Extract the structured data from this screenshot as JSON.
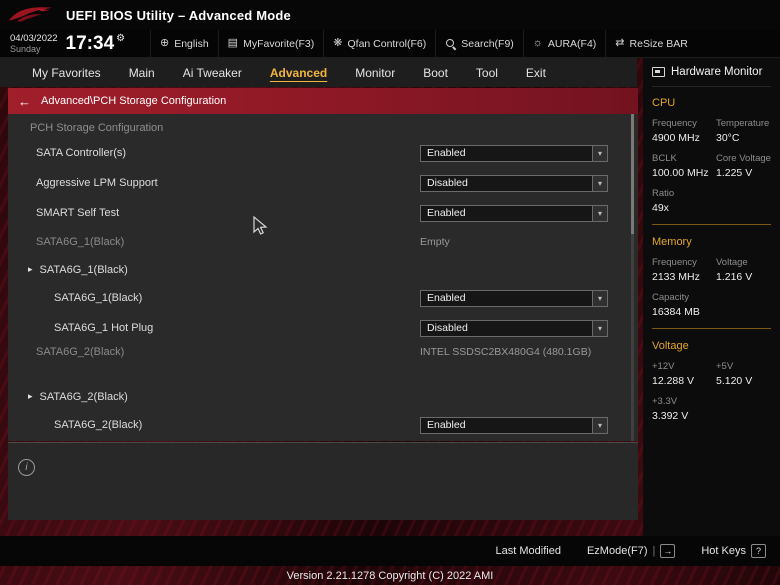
{
  "header": {
    "title": "UEFI BIOS Utility – Advanced Mode",
    "date": "04/03/2022",
    "day": "Sunday",
    "time": "17:34",
    "tools": [
      {
        "label": "English",
        "icon": "globe-icon"
      },
      {
        "label": "MyFavorite(F3)",
        "icon": "favorite-icon"
      },
      {
        "label": "Qfan Control(F6)",
        "icon": "fan-icon"
      },
      {
        "label": "Search(F9)",
        "icon": "search-icon"
      },
      {
        "label": "AURA(F4)",
        "icon": "aura-icon"
      },
      {
        "label": "ReSize BAR",
        "icon": "resize-bar-icon"
      }
    ]
  },
  "menu": {
    "items": [
      {
        "label": "My Favorites",
        "active": false
      },
      {
        "label": "Main",
        "active": false
      },
      {
        "label": "Ai Tweaker",
        "active": false
      },
      {
        "label": "Advanced",
        "active": true
      },
      {
        "label": "Monitor",
        "active": false
      },
      {
        "label": "Boot",
        "active": false
      },
      {
        "label": "Tool",
        "active": false
      },
      {
        "label": "Exit",
        "active": false
      }
    ]
  },
  "breadcrumb": {
    "path": "Advanced\\PCH Storage Configuration"
  },
  "content": {
    "section_title": "PCH Storage Configuration",
    "rows": [
      {
        "label": "SATA Controller(s)",
        "control": "select",
        "value": "Enabled"
      },
      {
        "label": "Aggressive LPM Support",
        "control": "select",
        "value": "Disabled"
      },
      {
        "label": "SMART Self Test",
        "control": "select",
        "value": "Enabled"
      },
      {
        "label": "SATA6G_1(Black)",
        "control": "static",
        "value": "Empty"
      },
      {
        "label": "SATA6G_1(Black)",
        "control": "expand"
      },
      {
        "label": "SATA6G_1(Black)",
        "control": "select",
        "value": "Enabled",
        "indent": 1
      },
      {
        "label": "SATA6G_1 Hot Plug",
        "control": "select",
        "value": "Disabled",
        "indent": 1
      },
      {
        "label": "SATA6G_2(Black)",
        "control": "static",
        "value": "INTEL SSDSC2BX480G4 (480.1GB)"
      },
      {
        "label": "SATA6G_2(Black)",
        "control": "expand"
      },
      {
        "label": "SATA6G_2(Black)",
        "control": "select",
        "value": "Enabled",
        "indent": 1
      }
    ]
  },
  "hardware_monitor": {
    "title": "Hardware Monitor",
    "sections": [
      {
        "title": "CPU",
        "rows": [
          {
            "cells": [
              {
                "label": "Frequency",
                "value": "4900 MHz"
              },
              {
                "label": "Temperature",
                "value": "30°C"
              }
            ]
          },
          {
            "cells": [
              {
                "label": "BCLK",
                "value": "100.00 MHz"
              },
              {
                "label": "Core Voltage",
                "value": "1.225 V"
              }
            ]
          },
          {
            "cells": [
              {
                "label": "Ratio",
                "value": "49x"
              }
            ]
          }
        ]
      },
      {
        "title": "Memory",
        "rows": [
          {
            "cells": [
              {
                "label": "Frequency",
                "value": "2133 MHz"
              },
              {
                "label": "Voltage",
                "value": "1.216 V"
              }
            ]
          },
          {
            "cells": [
              {
                "label": "Capacity",
                "value": "16384 MB"
              }
            ]
          }
        ]
      },
      {
        "title": "Voltage",
        "rows": [
          {
            "cells": [
              {
                "label": "+12V",
                "value": "12.288 V"
              },
              {
                "label": "+5V",
                "value": "5.120 V"
              }
            ]
          },
          {
            "cells": [
              {
                "label": "+3.3V",
                "value": "3.392 V"
              }
            ]
          }
        ]
      }
    ]
  },
  "footer": {
    "last_modified": "Last Modified",
    "ezmode": "EzMode(F7)",
    "hot_keys": "Hot Keys",
    "hot_keys_icon": "?",
    "version": "Version 2.21.1278 Copyright (C) 2022 AMI"
  }
}
